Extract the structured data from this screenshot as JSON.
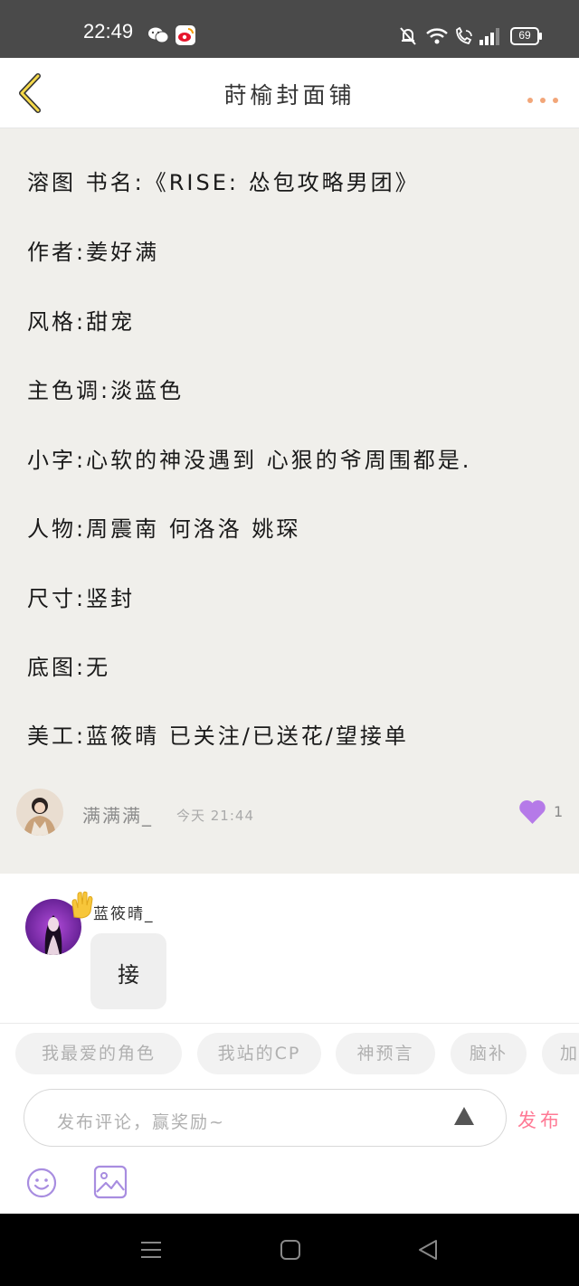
{
  "status_bar": {
    "time": "22:49",
    "battery": "69"
  },
  "header": {
    "title": "莳榆封面铺"
  },
  "post": {
    "lines": [
      "溶图 书名:《RISE: 怂包攻略男团》",
      "作者:姜好满",
      "风格:甜宠",
      "主色调:淡蓝色",
      "小字:心软的神没遇到 心狠的爷周围都是.",
      "人物:周震南 何洛洛 姚琛",
      "尺寸:竖封",
      "底图:无",
      "美工:蓝筱晴 已关注/已送花/望接单"
    ],
    "author": "满满满_",
    "time": "今天 21:44",
    "likes": "1",
    "like_color": "#b57ae8"
  },
  "reply": {
    "name": "蓝筱晴_",
    "text": "接"
  },
  "tags": [
    "我最爱的角色",
    "我站的CP",
    "神预言",
    "脑补",
    "加"
  ],
  "comment_bar": {
    "placeholder": "发布评论，赢奖励~",
    "publish_label": "发布",
    "publish_color": "#ff7a95"
  },
  "icons": {
    "back": "chevron-left-icon",
    "more": "more-dots-icon",
    "like": "heart-icon",
    "emoji": "smiley-icon",
    "image": "image-icon"
  }
}
